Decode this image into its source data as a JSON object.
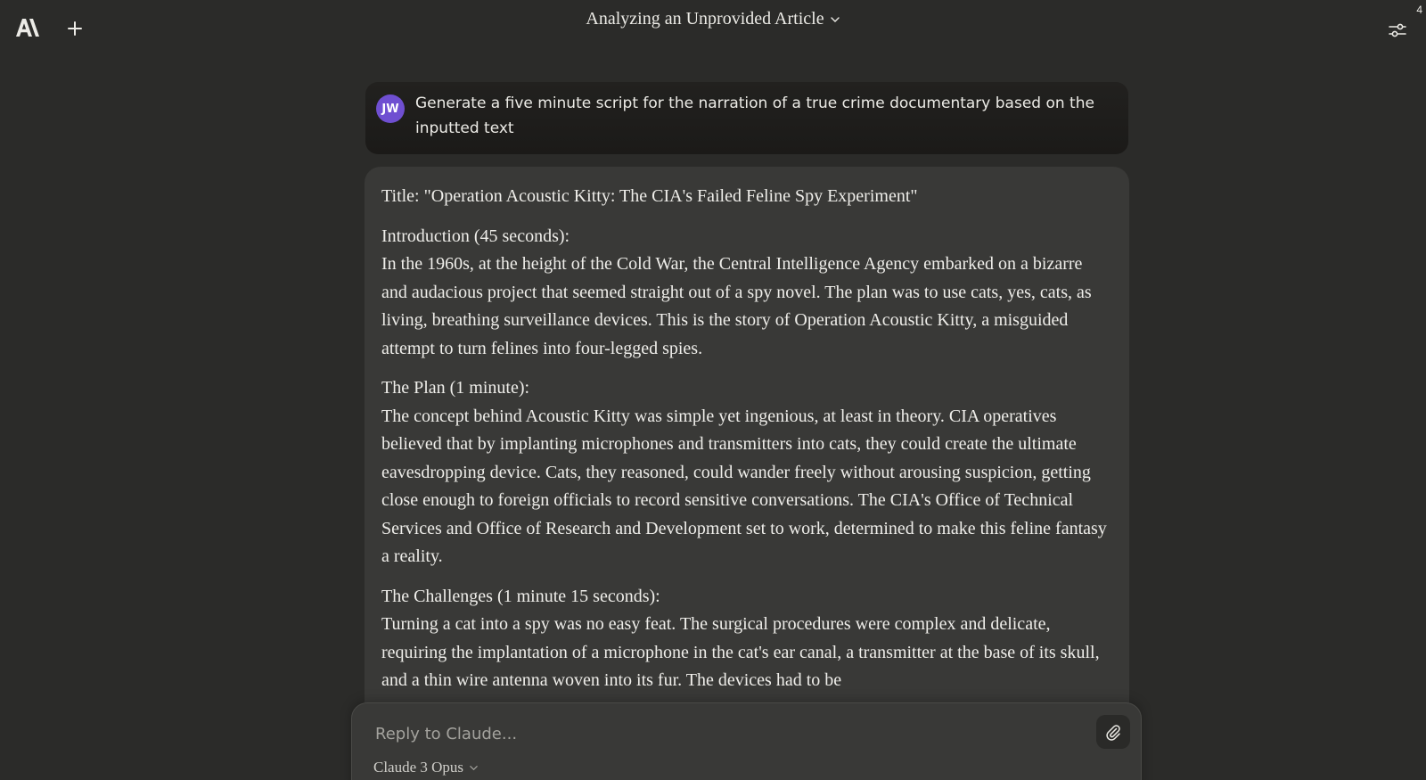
{
  "header": {
    "logo_icon": "anthropic-logo-icon",
    "new_chat_icon": "plus-icon",
    "title": "Analyzing an Unprovided Article",
    "title_dropdown_icon": "chevron-down-icon",
    "settings_icon": "sliders-icon",
    "notification_count": "4"
  },
  "user_message": {
    "avatar_initials": "JW",
    "avatar_color": "#6f4fd1",
    "text": "Generate a five minute script for the narration of a true crime documentary based on the inputted text"
  },
  "assistant_message": {
    "paragraphs": [
      {
        "heading": "Title: \"Operation Acoustic Kitty: The CIA's Failed Feline Spy Experiment\"",
        "body": ""
      },
      {
        "heading": "Introduction (45 seconds):",
        "body": "In the 1960s, at the height of the Cold War, the Central Intelligence Agency embarked on a bizarre and audacious project that seemed straight out of a spy novel. The plan was to use cats, yes, cats, as living, breathing surveillance devices. This is the story of Operation Acoustic Kitty, a misguided attempt to turn felines into four-legged spies."
      },
      {
        "heading": "The Plan (1 minute):",
        "body": "The concept behind Acoustic Kitty was simple yet ingenious, at least in theory. CIA operatives believed that by implanting microphones and transmitters into cats, they could create the ultimate eavesdropping device. Cats, they reasoned, could wander freely without arousing suspicion, getting close enough to foreign officials to record sensitive conversations. The CIA's Office of Technical Services and Office of Research and Development set to work, determined to make this feline fantasy a reality."
      },
      {
        "heading": "The Challenges (1 minute 15 seconds):",
        "body": "Turning a cat into a spy was no easy feat. The surgical procedures were complex and delicate, requiring the implantation of a microphone in the cat's ear canal, a transmitter at the base of its skull, and a thin wire antenna woven into its fur. The devices had to be"
      }
    ]
  },
  "composer": {
    "placeholder": "Reply to Claude...",
    "value": "",
    "attach_icon": "paperclip-icon",
    "model_label": "Claude 3 Opus",
    "model_dropdown_icon": "chevron-down-icon"
  }
}
